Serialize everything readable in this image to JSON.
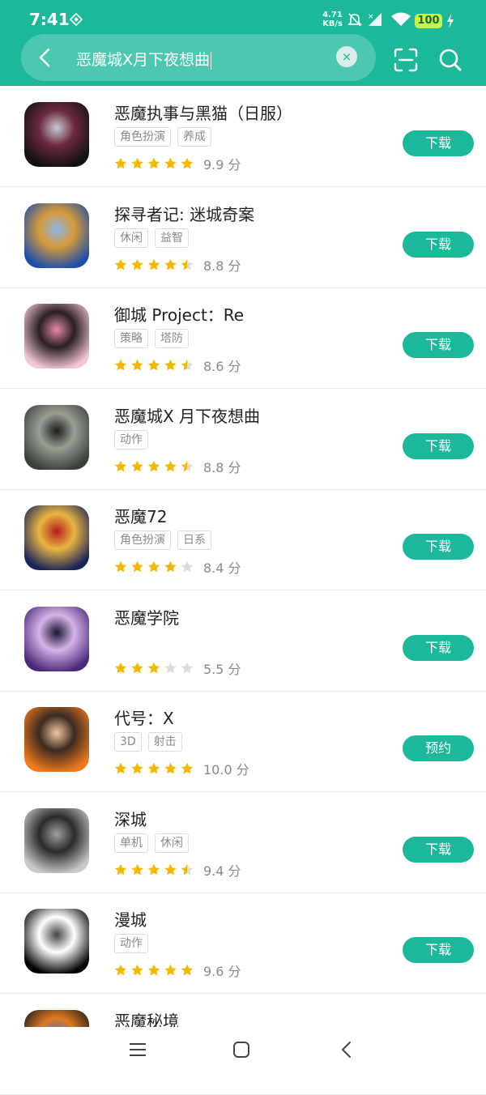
{
  "status_bar": {
    "time": "7:41",
    "net_speed": "4.71",
    "net_unit": "KB/s",
    "battery": "100"
  },
  "search": {
    "query": "恶魔城X月下夜想曲",
    "clear_symbol": "×"
  },
  "apps": [
    {
      "name": "恶魔执事与黑猫（日服）",
      "tags": [
        "角色扮演",
        "养成"
      ],
      "stars": 5,
      "score": "9.9 分",
      "action": "下载",
      "icon_colors": [
        "#111111",
        "#6b2a3f",
        "#c9c9d6"
      ]
    },
    {
      "name": "探寻者记: 迷城奇案",
      "tags": [
        "休闲",
        "益智"
      ],
      "stars": 4.5,
      "score": "8.8 分",
      "action": "下载",
      "icon_colors": [
        "#1e4fa8",
        "#d79a3a",
        "#8bb5e8"
      ]
    },
    {
      "name": "御城 Project：Re",
      "tags": [
        "策略",
        "塔防"
      ],
      "stars": 4.5,
      "score": "8.6 分",
      "action": "下载",
      "icon_colors": [
        "#f4c6d4",
        "#2a1e24",
        "#e28aa6"
      ]
    },
    {
      "name": "恶魔城X 月下夜想曲",
      "tags": [
        "动作"
      ],
      "stars": 4.5,
      "score": "8.8 分",
      "action": "下载",
      "icon_colors": [
        "#3b3f3a",
        "#9a9f95",
        "#1b1d1a"
      ]
    },
    {
      "name": "恶魔72",
      "tags": [
        "角色扮演",
        "日系"
      ],
      "stars": 4,
      "score": "8.4 分",
      "action": "下载",
      "icon_colors": [
        "#1b2457",
        "#e9b642",
        "#b21d1d"
      ]
    },
    {
      "name": "恶魔学院",
      "tags": [],
      "stars": 3,
      "score": "5.5 分",
      "action": "下载",
      "icon_colors": [
        "#4a2a7a",
        "#d6b3e8",
        "#1a1530"
      ]
    },
    {
      "name": "代号：X",
      "tags": [
        "3D",
        "射击"
      ],
      "stars": 5,
      "score": "10.0 分",
      "action": "预约",
      "icon_colors": [
        "#f07a1c",
        "#3a2a20",
        "#f4c7a0"
      ]
    },
    {
      "name": "深城",
      "tags": [
        "单机",
        "休闲"
      ],
      "stars": 4.5,
      "score": "9.4 分",
      "action": "下载",
      "icon_colors": [
        "#c9c9c9",
        "#2a2a2a",
        "#a0a0a0"
      ]
    },
    {
      "name": "漫城",
      "tags": [
        "动作"
      ],
      "stars": 5,
      "score": "9.6 分",
      "action": "下载",
      "icon_colors": [
        "#000000",
        "#ffffff",
        "#444444"
      ]
    },
    {
      "name": "恶魔秘境",
      "tags": [],
      "stars": 0,
      "score": "",
      "action": "",
      "icon_colors": [
        "#1a1a1a",
        "#e07a20",
        "#3b6fd8"
      ]
    }
  ],
  "colors": {
    "accent": "#1bb99a",
    "star": "#f5b800",
    "star_empty": "#dcdcdc"
  }
}
